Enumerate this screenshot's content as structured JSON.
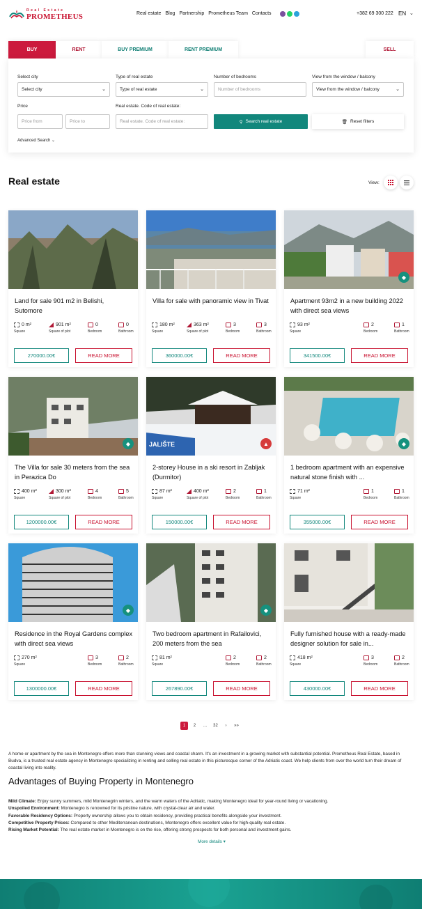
{
  "brand": {
    "top": "Real Estate",
    "name": "PROMETHEUS"
  },
  "nav": [
    "Real estate",
    "Blog",
    "Partnership",
    "Prometheus Team",
    "Contacts"
  ],
  "phone": "+382 69 300 222",
  "lang": "EN",
  "tabs": {
    "buy": "BUY",
    "rent": "RENT",
    "buy_premium": "BUY PREMIUM",
    "rent_premium": "RENT PREMIUM",
    "sell": "SELL"
  },
  "filters": {
    "city_label": "Select city",
    "city_value": "Select city",
    "type_label": "Type of real estate",
    "type_value": "Type of real estate",
    "bedrooms_label": "Number of bedrooms",
    "bedrooms_placeholder": "Number of bedrooms",
    "view_label": "View from the window / balcony",
    "view_value": "View from the window / balcony",
    "price_label": "Price",
    "price_from": "Price from",
    "price_to": "Price to",
    "code_label": "Real estate. Code of real estate:",
    "code_placeholder": "Real estate. Code of real estate:",
    "search_btn": "Search real estate",
    "reset_btn": "Reset filters",
    "advanced": "Advanced Search"
  },
  "section_title": "Real estate",
  "view_label": "View:",
  "labels": {
    "square": "Square",
    "plot": "Square of plot",
    "bedroom": "Bedroom",
    "bathroom": "Bathroom",
    "read_more": "READ MORE"
  },
  "listings": [
    {
      "title": "Land for sale 901 m2 in Belishi, Sutomore",
      "square": "0 m²",
      "plot": "901 m²",
      "bedroom": "0",
      "bathroom": "0",
      "price": "270000.00€",
      "badge": ""
    },
    {
      "title": "Villa for sale with panoramic view in Tivat",
      "square": "180 m²",
      "plot": "363 m²",
      "bedroom": "3",
      "bathroom": "3",
      "price": "360000.00€",
      "badge": ""
    },
    {
      "title": "Apartment 93m2 in a new building 2022 with direct sea views",
      "square": "93 m²",
      "plot": "",
      "bedroom": "2",
      "bathroom": "1",
      "price": "341500.00€",
      "badge": "diamond"
    },
    {
      "title": "The Villa for sale 30 meters from the sea in Perazica Do",
      "square": "400 m²",
      "plot": "300 m²",
      "bedroom": "4",
      "bathroom": "5",
      "price": "1200000.00€",
      "badge": "diamond"
    },
    {
      "title": "2-storey House in a ski resort in Zabljak (Durmitor)",
      "square": "87 m²",
      "plot": "400 m²",
      "bedroom": "2",
      "bathroom": "1",
      "price": "150000.00€",
      "badge": "fire"
    },
    {
      "title": "1 bedroom apartment with an expensive natural stone finish with ...",
      "square": "71 m²",
      "plot": "",
      "bedroom": "1",
      "bathroom": "1",
      "price": "355000.00€",
      "badge": "diamond"
    },
    {
      "title": "Residence in the Royal Gardens complex with direct sea views",
      "square": "270 m²",
      "plot": "",
      "bedroom": "3",
      "bathroom": "2",
      "price": "1300000.00€",
      "badge": "diamond"
    },
    {
      "title": "Two bedroom apartment in Rafailovici, 200 meters from the sea",
      "square": "81 m²",
      "plot": "",
      "bedroom": "2",
      "bathroom": "2",
      "price": "267890.00€",
      "badge": "diamond"
    },
    {
      "title": "Fully furnished house with a ready-made designer solution for sale in...",
      "square": "418 m²",
      "plot": "",
      "bedroom": "3",
      "bathroom": "2",
      "price": "430000.00€",
      "badge": ""
    }
  ],
  "pagination": {
    "current": "1",
    "next_page": "2",
    "ellipsis": "...",
    "last": "32",
    "next": "›",
    "last_arrow": "»»"
  },
  "intro": "A home or apartment by the sea in Montenegro offers more than stunning views and coastal charm. It's an investment in a growing market with substantial potential. Prometheus Real Estate, based in Budva, is a trusted real estate agency in Montenegro specializing in renting and selling real estate in this picturesque corner of the Adriatic coast. We help clients from over the world turn their dream of coastal living into reality.",
  "advantages_title": "Advantages of Buying Property in Montenegro",
  "advantages": [
    {
      "term": "Mild Climate:",
      "text": " Enjoy sunny summers, mild Montenegrin winters, and the warm waters of the Adriatic, making Montenegro ideal for year-round living or vacationing."
    },
    {
      "term": "Unspoiled Environment:",
      "text": " Montenegro is renowned for its pristine nature, with crystal-clear air and water."
    },
    {
      "term": "Favorable Residency Options:",
      "text": " Property ownership allows you to obtain residency, providing practical benefits alongside your investment."
    },
    {
      "term": "Competitive Property Prices:",
      "text": " Compared to other Mediterranean destinations, Montenegro offers excellent value for high-quality real estate."
    },
    {
      "term": "Rising Market Potential:",
      "text": " The real estate market in Montenegro is on the rise, offering strong prospects for both personal and investment gains."
    }
  ],
  "more_details": "More details",
  "colors": {
    "brand_red": "#cc1a3d",
    "brand_teal": "#12877c"
  }
}
